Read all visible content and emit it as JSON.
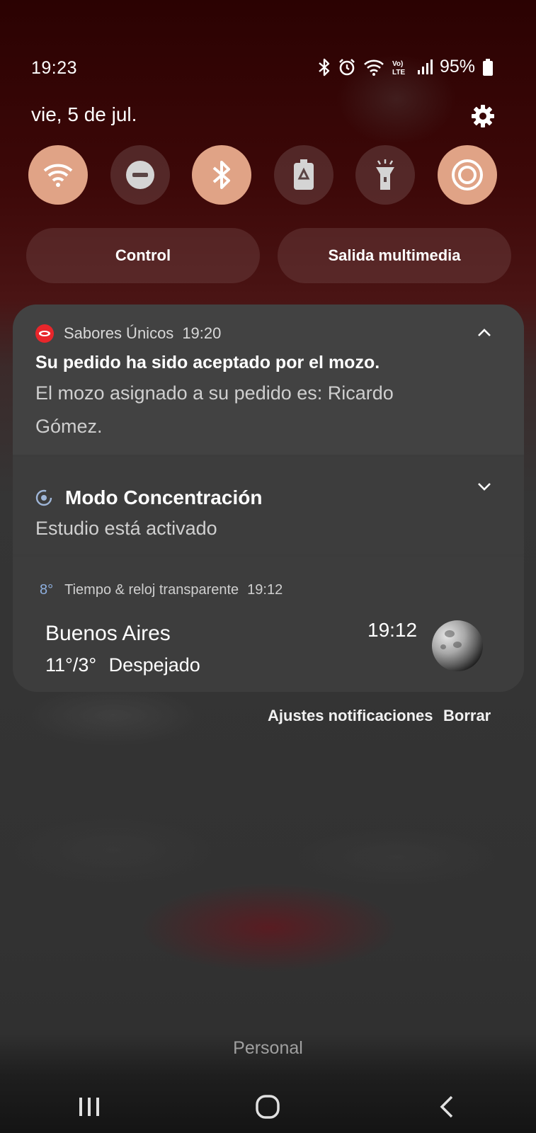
{
  "status_bar": {
    "time": "19:23",
    "battery": "95%",
    "icons": [
      "bluetooth-icon",
      "alarm-icon",
      "wifi-icon",
      "volte-icon",
      "signal-icon",
      "battery-icon"
    ],
    "network_label": "Vo) LTE"
  },
  "header": {
    "date": "vie, 5 de jul.",
    "settings_icon": "gear-icon"
  },
  "quick_settings": [
    {
      "name": "wifi",
      "icon": "wifi-icon",
      "state": "on"
    },
    {
      "name": "do-not-disturb",
      "icon": "minus-circle-icon",
      "state": "off"
    },
    {
      "name": "bluetooth",
      "icon": "bluetooth-icon",
      "state": "on"
    },
    {
      "name": "power-saving",
      "icon": "battery-recycle-icon",
      "state": "off"
    },
    {
      "name": "flashlight",
      "icon": "flashlight-icon",
      "state": "off"
    },
    {
      "name": "focus-target",
      "icon": "target-icon",
      "state": "on"
    }
  ],
  "pills": {
    "control": "Control",
    "media": "Salida multimedia"
  },
  "notifications": {
    "order": {
      "app": "Sabores Únicos",
      "time": "19:20",
      "title": "Su pedido ha sido aceptado por el mozo.",
      "body": "El mozo asignado a su pedido es: Ricardo Gómez."
    },
    "focus": {
      "title": "Modo Concentración",
      "subtitle": "Estudio está activado"
    },
    "weather": {
      "temp_small": "8°",
      "app": "Tiempo & reloj transparente",
      "time": "19:12",
      "city": "Buenos Aires",
      "range": "11°/3°",
      "condition": "Despejado",
      "clock": "19:12"
    }
  },
  "actions": {
    "settings": "Ajustes notificaciones",
    "clear": "Borrar"
  },
  "footer": {
    "profile": "Personal"
  },
  "colors": {
    "tile_on": "#e0a386",
    "card_bg": "#3d3d3d",
    "brand_red": "#e8262b"
  }
}
